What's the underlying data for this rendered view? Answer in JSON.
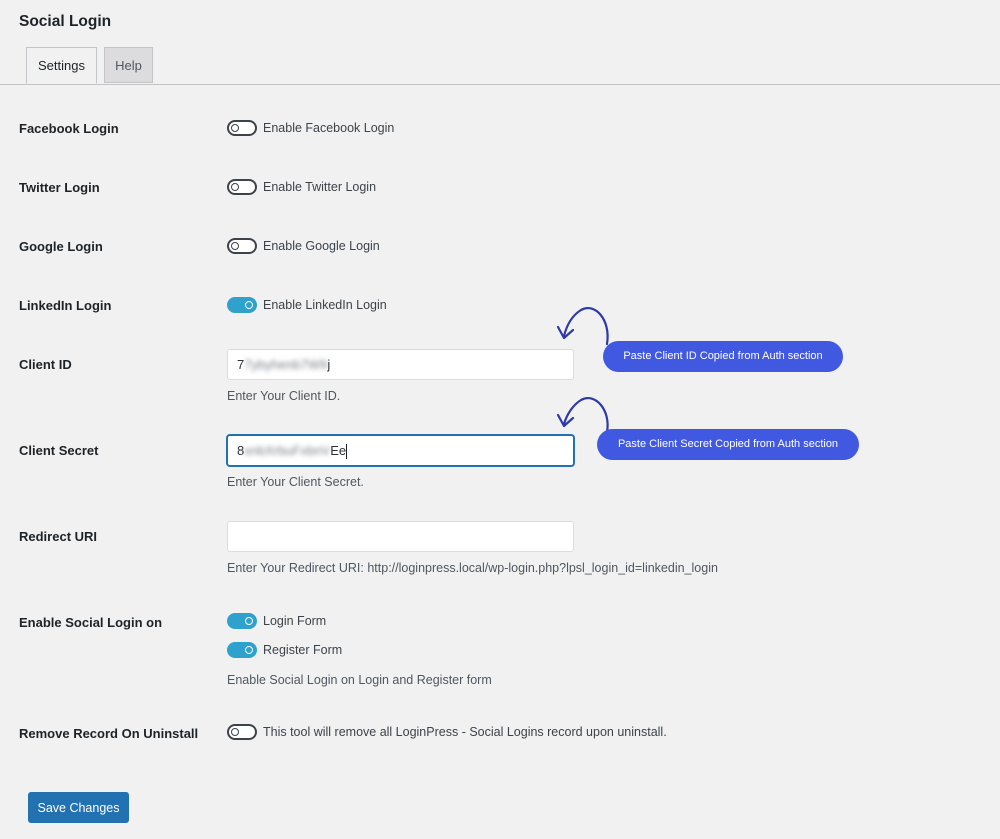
{
  "page_title": "Social Login",
  "tabs": [
    {
      "label": "Settings",
      "active": true
    },
    {
      "label": "Help",
      "active": false
    }
  ],
  "settings": {
    "facebook": {
      "label": "Facebook Login",
      "toggle_label": "Enable Facebook Login",
      "enabled": false
    },
    "twitter": {
      "label": "Twitter Login",
      "toggle_label": "Enable Twitter Login",
      "enabled": false
    },
    "google": {
      "label": "Google Login",
      "toggle_label": "Enable Google Login",
      "enabled": false
    },
    "linkedin": {
      "label": "LinkedIn Login",
      "toggle_label": "Enable LinkedIn Login",
      "enabled": true
    },
    "client_id": {
      "label": "Client ID",
      "value_prefix": "7",
      "value_hidden": "7ybyhenb7W9",
      "value_suffix": "j",
      "description": "Enter Your Client ID."
    },
    "client_secret": {
      "label": "Client Secret",
      "value_prefix": "8",
      "value_hidden": "xnbXrbuFxbnV",
      "value_suffix": "Ee",
      "description": "Enter Your Client Secret."
    },
    "redirect_uri": {
      "label": "Redirect URI",
      "value": "",
      "description": "Enter Your Redirect URI: http://loginpress.local/wp-login.php?lpsl_login_id=linkedin_login"
    },
    "social_login_on": {
      "label": "Enable Social Login on",
      "login_form": {
        "toggle_label": "Login Form",
        "enabled": true
      },
      "register_form": {
        "toggle_label": "Register Form",
        "enabled": true
      },
      "description": "Enable Social Login on Login and Register form"
    },
    "remove_record": {
      "label": "Remove Record On Uninstall",
      "toggle_label": "This tool will remove all LoginPress - Social Logins record upon uninstall.",
      "enabled": false
    }
  },
  "callouts": {
    "client_id": "Paste Client ID Copied from Auth section",
    "client_secret": "Paste Client Secret Copied from Auth section"
  },
  "save_button": "Save Changes",
  "colors": {
    "toggle_on": "#2ea2cc",
    "primary_button": "#2271b1",
    "callout": "#4159e0"
  }
}
